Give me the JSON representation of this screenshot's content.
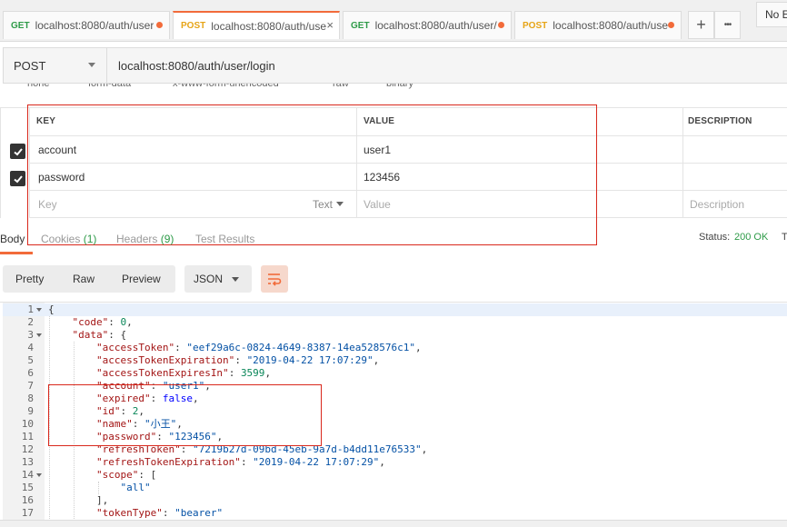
{
  "tabs": [
    {
      "method": "GET",
      "url": "localhost:8080/auth/user",
      "active": false
    },
    {
      "method": "POST",
      "url": "localhost:8080/auth/use",
      "active": true
    },
    {
      "method": "GET",
      "url": "localhost:8080/auth/user/",
      "active": false
    },
    {
      "method": "POST",
      "url": "localhost:8080/auth/use",
      "active": false
    }
  ],
  "tab_actions": {
    "add": "+",
    "more": "•••"
  },
  "environment": {
    "selected": "No E"
  },
  "request": {
    "method": "POST",
    "url": "localhost:8080/auth/user/login"
  },
  "body_types": [
    "none",
    "form-data",
    "x-www-form-urlencoded",
    "raw",
    "binary"
  ],
  "params_table": {
    "headers": {
      "key": "KEY",
      "value": "VALUE",
      "description": "DESCRIPTION"
    },
    "rows": [
      {
        "checked": true,
        "key": "account",
        "value": "user1"
      },
      {
        "checked": true,
        "key": "password",
        "value": "123456"
      }
    ],
    "new_row": {
      "key_placeholder": "Key",
      "type": "Text",
      "value_placeholder": "Value",
      "description_placeholder": "Description"
    }
  },
  "response_tabs": {
    "body": "Body",
    "cookies": "Cookies",
    "cookies_count": "(1)",
    "headers": "Headers",
    "headers_count": "(9)",
    "tests": "Test Results"
  },
  "status": {
    "label": "Status:",
    "value": "200 OK",
    "time_label": "T"
  },
  "response_toolbar": {
    "pretty": "Pretty",
    "raw": "Raw",
    "preview": "Preview",
    "format": "JSON"
  },
  "response_lines": [
    {
      "n": "1",
      "fold": true,
      "parts": [
        [
          "p",
          "{"
        ]
      ]
    },
    {
      "n": "2",
      "fold": false,
      "parts": [
        [
          "p",
          "    "
        ],
        [
          "k",
          "\"code\""
        ],
        [
          "p",
          ": "
        ],
        [
          "n",
          "0"
        ],
        [
          "p",
          ","
        ]
      ]
    },
    {
      "n": "3",
      "fold": true,
      "parts": [
        [
          "p",
          "    "
        ],
        [
          "k",
          "\"data\""
        ],
        [
          "p",
          ": {"
        ]
      ]
    },
    {
      "n": "4",
      "fold": false,
      "parts": [
        [
          "p",
          "        "
        ],
        [
          "k",
          "\"accessToken\""
        ],
        [
          "p",
          ": "
        ],
        [
          "s",
          "\"eef29a6c-0824-4649-8387-14ea528576c1\""
        ],
        [
          "p",
          ","
        ]
      ]
    },
    {
      "n": "5",
      "fold": false,
      "parts": [
        [
          "p",
          "        "
        ],
        [
          "k",
          "\"accessTokenExpiration\""
        ],
        [
          "p",
          ": "
        ],
        [
          "s",
          "\"2019-04-22 17:07:29\""
        ],
        [
          "p",
          ","
        ]
      ]
    },
    {
      "n": "6",
      "fold": false,
      "parts": [
        [
          "p",
          "        "
        ],
        [
          "k",
          "\"accessTokenExpiresIn\""
        ],
        [
          "p",
          ": "
        ],
        [
          "n",
          "3599"
        ],
        [
          "p",
          ","
        ]
      ]
    },
    {
      "n": "7",
      "fold": false,
      "parts": [
        [
          "p",
          "        "
        ],
        [
          "k",
          "\"account\""
        ],
        [
          "p",
          ": "
        ],
        [
          "s",
          "\"user1\""
        ],
        [
          "p",
          ","
        ]
      ]
    },
    {
      "n": "8",
      "fold": false,
      "parts": [
        [
          "p",
          "        "
        ],
        [
          "k",
          "\"expired\""
        ],
        [
          "p",
          ": "
        ],
        [
          "b",
          "false"
        ],
        [
          "p",
          ","
        ]
      ]
    },
    {
      "n": "9",
      "fold": false,
      "parts": [
        [
          "p",
          "        "
        ],
        [
          "k",
          "\"id\""
        ],
        [
          "p",
          ": "
        ],
        [
          "n",
          "2"
        ],
        [
          "p",
          ","
        ]
      ]
    },
    {
      "n": "10",
      "fold": false,
      "parts": [
        [
          "p",
          "        "
        ],
        [
          "k",
          "\"name\""
        ],
        [
          "p",
          ": "
        ],
        [
          "s",
          "\"小王\""
        ],
        [
          "p",
          ","
        ]
      ]
    },
    {
      "n": "11",
      "fold": false,
      "parts": [
        [
          "p",
          "        "
        ],
        [
          "k",
          "\"password\""
        ],
        [
          "p",
          ": "
        ],
        [
          "s",
          "\"123456\""
        ],
        [
          "p",
          ","
        ]
      ]
    },
    {
      "n": "12",
      "fold": false,
      "parts": [
        [
          "p",
          "        "
        ],
        [
          "k",
          "\"refreshToken\""
        ],
        [
          "p",
          ": "
        ],
        [
          "s",
          "\"7219b27d-09bd-45eb-9a7d-b4dd11e76533\""
        ],
        [
          "p",
          ","
        ]
      ]
    },
    {
      "n": "13",
      "fold": false,
      "parts": [
        [
          "p",
          "        "
        ],
        [
          "k",
          "\"refreshTokenExpiration\""
        ],
        [
          "p",
          ": "
        ],
        [
          "s",
          "\"2019-04-22 17:07:29\""
        ],
        [
          "p",
          ","
        ]
      ]
    },
    {
      "n": "14",
      "fold": true,
      "parts": [
        [
          "p",
          "        "
        ],
        [
          "k",
          "\"scope\""
        ],
        [
          "p",
          ": ["
        ]
      ]
    },
    {
      "n": "15",
      "fold": false,
      "parts": [
        [
          "p",
          "            "
        ],
        [
          "s",
          "\"all\""
        ]
      ]
    },
    {
      "n": "16",
      "fold": false,
      "parts": [
        [
          "p",
          "        ],"
        ]
      ]
    },
    {
      "n": "17",
      "fold": false,
      "parts": [
        [
          "p",
          "        "
        ],
        [
          "k",
          "\"tokenType\""
        ],
        [
          "p",
          ": "
        ],
        [
          "s",
          "\"bearer\""
        ]
      ]
    }
  ],
  "colors": {
    "accent": "#f26b3a",
    "get": "#2e9b48",
    "post": "#e6a417",
    "annotation": "#d9281c"
  }
}
